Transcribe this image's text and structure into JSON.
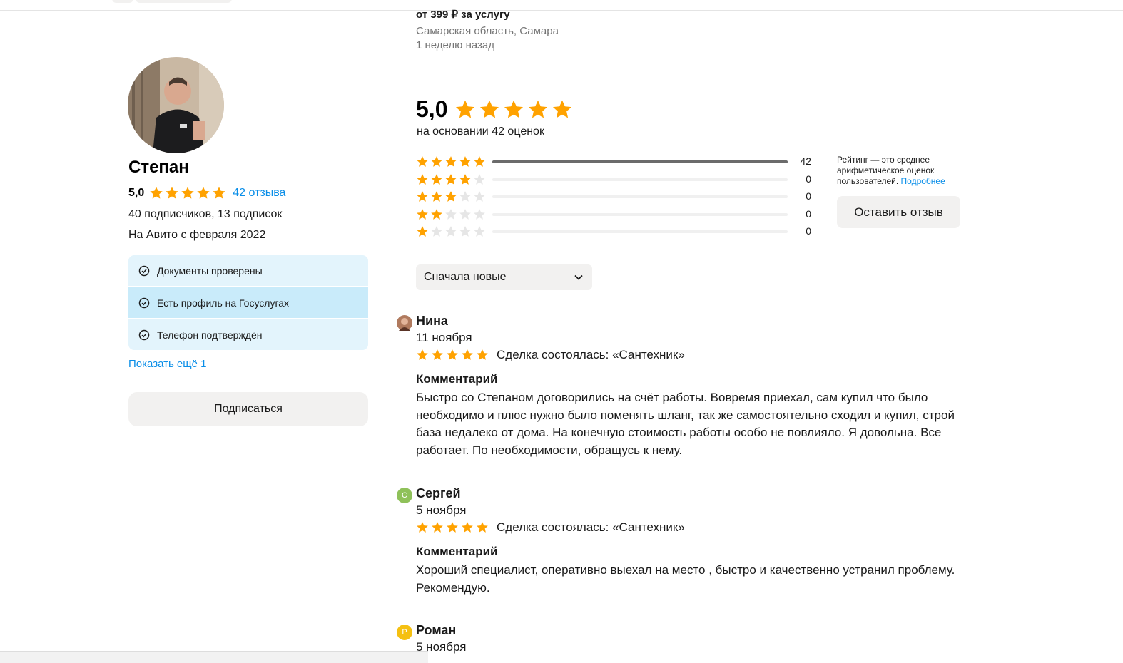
{
  "listing": {
    "price": "от 399 ₽ за услугу",
    "location": "Самарская область, Самара",
    "posted": "1 неделю назад"
  },
  "seller": {
    "name": "Степан",
    "rating": "5,0",
    "stars": 5,
    "reviews_link": "42 отзыва",
    "followers": "40 подписчиков, 13 подписок",
    "since": "На Авито с февраля 2022",
    "badges": [
      {
        "label": "Документы проверены",
        "icon": "check-circle-icon"
      },
      {
        "label": "Есть профиль на Госуслугах",
        "icon": "check-circle-icon"
      },
      {
        "label": "Телефон подтверждён",
        "icon": "check-circle-icon"
      }
    ],
    "show_more": "Показать ещё 1",
    "subscribe": "Подписаться"
  },
  "summary": {
    "rating": "5,0",
    "based_on": "на основании 42 оценок",
    "distribution": [
      {
        "stars": 5,
        "count": "42",
        "fraction": 1.0
      },
      {
        "stars": 4,
        "count": "0",
        "fraction": 0
      },
      {
        "stars": 3,
        "count": "0",
        "fraction": 0
      },
      {
        "stars": 2,
        "count": "0",
        "fraction": 0
      },
      {
        "stars": 1,
        "count": "0",
        "fraction": 0
      }
    ],
    "info_text": "Рейтинг — это среднее арифметическое оценок пользователей.",
    "info_link": "Подробнее",
    "leave_review": "Оставить отзыв"
  },
  "sort": {
    "selected": "Сначала новые"
  },
  "reviews": [
    {
      "name": "Нина",
      "avatar_letter": "",
      "avatar_color": "#a0604a",
      "date": "11 ноября",
      "stars": 5,
      "deal": "Сделка состоялась: «Сантехник»",
      "comment_label": "Комментарий",
      "text": "Быстро со Степаном договорились на счёт работы. Вовремя приехал, сам купил что было необходимо и плюс нужно было поменять шланг, так же самостоятельно сходил и купил, строй база недалеко от дома. На конечную стоимость работы особо не повлияло. Я довольна. Все работает. По необходимости, обращусь к нему."
    },
    {
      "name": "Сергей",
      "avatar_letter": "С",
      "avatar_color": "#8fc15a",
      "date": "5 ноября",
      "stars": 5,
      "deal": "Сделка состоялась: «Сантехник»",
      "comment_label": "Комментарий",
      "text": "Хороший специалист, оперативно выехал на место , быстро и качественно устранил проблему. Рекомендую."
    },
    {
      "name": "Роман",
      "avatar_letter": "Р",
      "avatar_color": "#f5c011",
      "date": "5 ноября"
    }
  ],
  "colors": {
    "star": "#ffa200",
    "link": "#0a8ee8",
    "badge_bg": "#e3f4fc"
  }
}
